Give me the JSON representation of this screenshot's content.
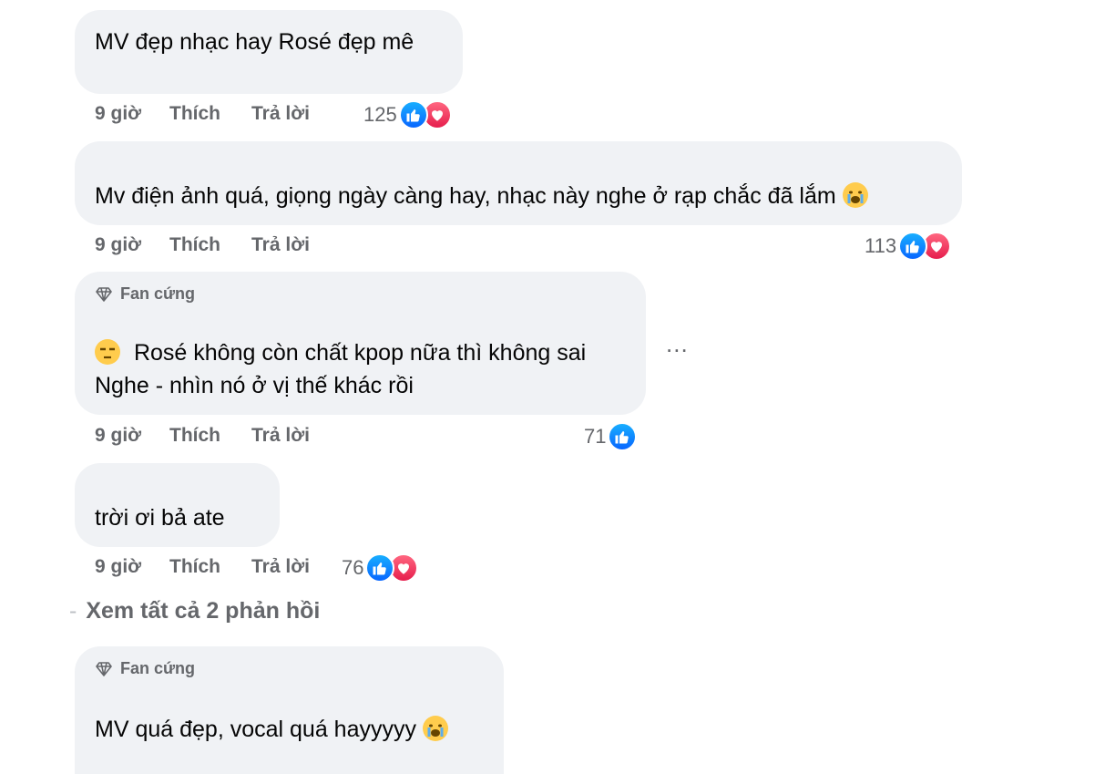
{
  "comments": [
    {
      "text": "MV đẹp nhạc hay Rosé đẹp mê",
      "time": "9 giờ",
      "like": "Thích",
      "reply": "Trả lời",
      "count": "125",
      "reactions": [
        "like-icon",
        "love-icon"
      ]
    },
    {
      "text": "Mv điện ảnh quá, giọng ngày càng hay, nhạc này nghe ở rạp chắc đã lắm",
      "emoji": "crying-face-icon",
      "time": "9 giờ",
      "like": "Thích",
      "reply": "Trả lời",
      "count": "113",
      "reactions": [
        "like-icon",
        "love-icon"
      ]
    },
    {
      "badge": "Fan cứng",
      "line1": "Rosé không còn chất kpop nữa thì không sai",
      "line2": "Nghe - nhìn nó ở vị thế khác rồi",
      "emoji": "unamused-face-icon",
      "time": "9 giờ",
      "like": "Thích",
      "reply": "Trả lời",
      "count": "71",
      "reactions": [
        "like-icon"
      ]
    },
    {
      "text": "trời ơi bả ate",
      "time": "9 giờ",
      "like": "Thích",
      "reply": "Trả lời",
      "count": "76",
      "reactions": [
        "like-icon",
        "love-icon"
      ]
    },
    {
      "badge": "Fan cứng",
      "text": "MV quá đẹp, vocal quá hayyyyy",
      "emoji": "crying-face-icon"
    }
  ],
  "view_replies": "Xem tất cả 2 phản hồi",
  "more_menu": "...",
  "colors": {
    "bubble": "#f0f2f5",
    "meta": "#65676b",
    "like": "#0866ff",
    "love": "#e61e4d"
  }
}
